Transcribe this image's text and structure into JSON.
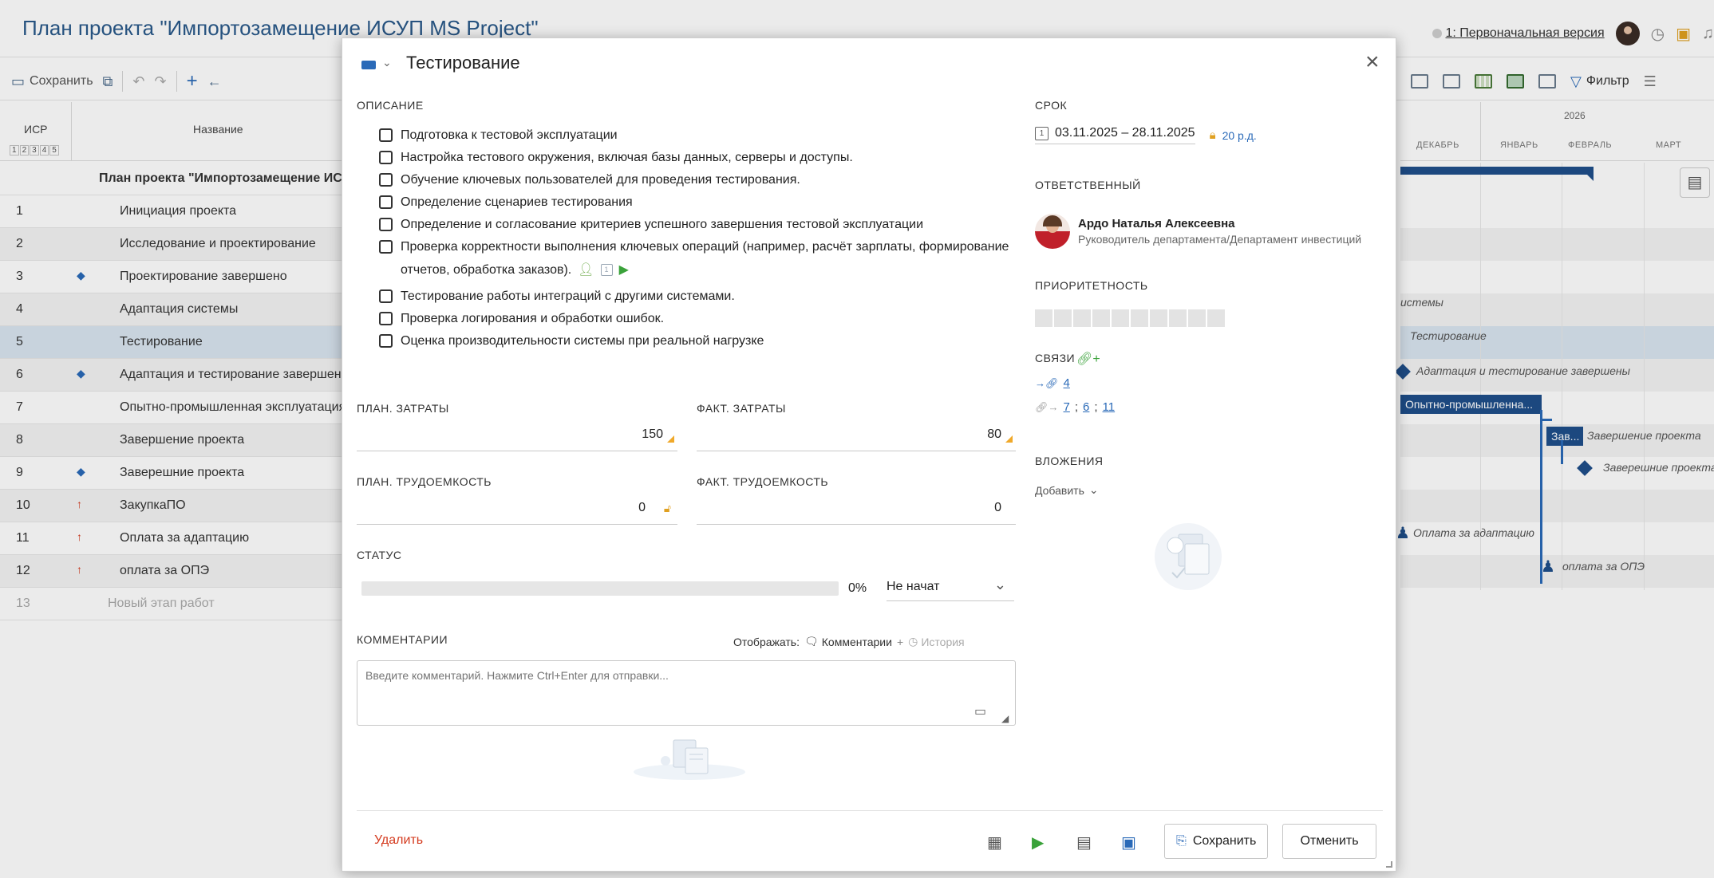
{
  "page": {
    "title": "План проекта \"Импортозамещение ИСУП MS Project\"",
    "version_label": "1: Первоначальная версия"
  },
  "toolbar": {
    "save_label": "Сохранить",
    "filter_label": "Фильтр"
  },
  "grid": {
    "col_isr": "ИСР",
    "levels": [
      "1",
      "2",
      "3",
      "4",
      "5"
    ],
    "col_name": "Название",
    "rows": [
      {
        "num": "",
        "name": "План проекта \"Импортозамещение ИСУП MS Project\"",
        "mark": ""
      },
      {
        "num": "1",
        "name": "Инициация проекта",
        "mark": ""
      },
      {
        "num": "2",
        "name": "Исследование и проектирование",
        "mark": ""
      },
      {
        "num": "3",
        "name": "Проектирование завершено",
        "mark": "◆"
      },
      {
        "num": "4",
        "name": "Адаптация системы",
        "mark": ""
      },
      {
        "num": "5",
        "name": "Тестирование",
        "mark": ""
      },
      {
        "num": "6",
        "name": "Адаптация и тестирование завершены",
        "mark": "◆"
      },
      {
        "num": "7",
        "name": "Опытно-промышленная эксплуатация",
        "mark": ""
      },
      {
        "num": "8",
        "name": "Завершение проекта",
        "mark": ""
      },
      {
        "num": "9",
        "name": "Заверешние проекта",
        "mark": "◆"
      },
      {
        "num": "10",
        "name": "ЗакупкаПО",
        "mark": "↑"
      },
      {
        "num": "11",
        "name": "Оплата за адаптацию",
        "mark": "↑"
      },
      {
        "num": "12",
        "name": "оплата за ОПЭ",
        "mark": "↑"
      },
      {
        "num": "13",
        "name": "Новый этап работ",
        "mark": ""
      }
    ]
  },
  "timeline": {
    "year": "2026",
    "months": [
      "ДЕКАБРЬ",
      "ЯНВАРЬ",
      "ФЕВРАЛЬ",
      "МАРТ"
    ],
    "labels": {
      "adapt_sys": "истемы",
      "testing": "Тестирование",
      "adapt_done": "Адаптация и тестирование завершены",
      "ope_bar": "Опытно-промышленна...",
      "finish_bar": "Зав...",
      "finish_text": "Завершение проекта",
      "finish_ms": "Заверешние проекта",
      "pay_adapt": "Оплата за адаптацию",
      "pay_ope": "оплата за ОПЭ"
    }
  },
  "modal": {
    "title": "Тестирование",
    "description_label": "ОПИСАНИЕ",
    "checklist": [
      "Подготовка к тестовой эксплуатации",
      "Настройка тестового окружения, включая базы данных, серверы и доступы.",
      "Обучение ключевых пользователей для проведения тестирования.",
      "Определение сценариев тестирования",
      "Определение и согласование критериев успешного завершения тестовой эксплуатации",
      "Проверка корректности выполнения ключевых операций (например, расчёт зарплаты, формирование отчетов, обработка заказов).",
      "Тестирование работы интеграций с другими системами.",
      "Проверка логирования и обработки ошибок.",
      "Оценка производительности системы при реальной нагрузке"
    ],
    "plan_cost_label": "ПЛАН. ЗАТРАТЫ",
    "plan_cost": "150",
    "fact_cost_label": "ФАКТ. ЗАТРАТЫ",
    "fact_cost": "80",
    "plan_labor_label": "ПЛАН. ТРУДОЕМКОСТЬ",
    "plan_labor": "0",
    "fact_labor_label": "ФАКТ. ТРУДОЕМКОСТЬ",
    "fact_labor": "0",
    "status_label": "СТАТУС",
    "progress": 0,
    "progress_text": "0%",
    "status_value": "Не начат",
    "comments_label": "КОММЕНТАРИИ",
    "show_label": "Отображать:",
    "comments_toggle": "Комментарии",
    "toggle_sep": "+",
    "history_toggle": "История",
    "comment_placeholder": "Введите комментарий. Нажмите Ctrl+Enter для отправки...",
    "term_label": "СРОК",
    "date_range": "03.11.2025 – 28.11.2025",
    "duration": "20 р.д.",
    "responsible_label": "ОТВЕТСТВЕННЫЙ",
    "responsible_name": "Ардо Наталья Алексеевна",
    "responsible_role": "Руководитель департамента/Департамент инвестиций",
    "priority_label": "ПРИОРИТЕТНОСТЬ",
    "priority_level": 0,
    "links_label": "СВЯЗИ",
    "links_in": [
      "4"
    ],
    "links_out": [
      "7",
      "6",
      "11"
    ],
    "attachments_label": "ВЛОЖЕНИЯ",
    "add_label": "Добавить",
    "delete_label": "Удалить",
    "save_label": "Сохранить",
    "cancel_label": "Отменить",
    "colors": {
      "accent": "#2a6ab8",
      "danger": "#d43a1e",
      "play": "#3aa23a",
      "lock": "#e0a020"
    }
  }
}
